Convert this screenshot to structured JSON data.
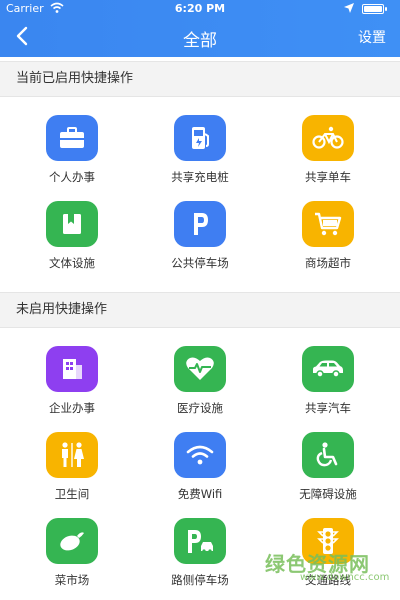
{
  "status_bar": {
    "carrier": "Carrier",
    "time": "6:20 PM"
  },
  "nav": {
    "title": "全部",
    "settings": "设置",
    "bg_color": "#3d8bf2"
  },
  "sections": {
    "enabled": {
      "title": "当前已启用快捷操作",
      "items": [
        {
          "label": "个人办事",
          "icon": "briefcase-icon",
          "color": "#3f7ef2"
        },
        {
          "label": "共享充电桩",
          "icon": "charging-station-icon",
          "color": "#3f7ef2"
        },
        {
          "label": "共享单车",
          "icon": "bicycle-icon",
          "color": "#f8b400"
        },
        {
          "label": "文体设施",
          "icon": "book-icon",
          "color": "#35b552"
        },
        {
          "label": "公共停车场",
          "icon": "parking-icon",
          "color": "#3f7ef2"
        },
        {
          "label": "商场超市",
          "icon": "shopping-cart-icon",
          "color": "#f8b400"
        }
      ]
    },
    "disabled": {
      "title": "未启用快捷操作",
      "items": [
        {
          "label": "企业办事",
          "icon": "building-icon",
          "color": "#8e3ff0"
        },
        {
          "label": "医疗设施",
          "icon": "heart-icon",
          "color": "#35b552"
        },
        {
          "label": "共享汽车",
          "icon": "car-icon",
          "color": "#35b552"
        },
        {
          "label": "卫生间",
          "icon": "restroom-icon",
          "color": "#f8b400"
        },
        {
          "label": "免费Wifi",
          "icon": "wifi-icon",
          "color": "#3f7ef2"
        },
        {
          "label": "无障碍设施",
          "icon": "wheelchair-icon",
          "color": "#35b552"
        },
        {
          "label": "菜市场",
          "icon": "vegetable-icon",
          "color": "#35b552"
        },
        {
          "label": "路侧停车场",
          "icon": "roadside-parking-icon",
          "color": "#35b552"
        },
        {
          "label": "交通路线",
          "icon": "traffic-light-icon",
          "color": "#f8b400"
        }
      ]
    }
  },
  "watermark": {
    "text": "绿色资源网",
    "url": "www.downcc.com"
  }
}
